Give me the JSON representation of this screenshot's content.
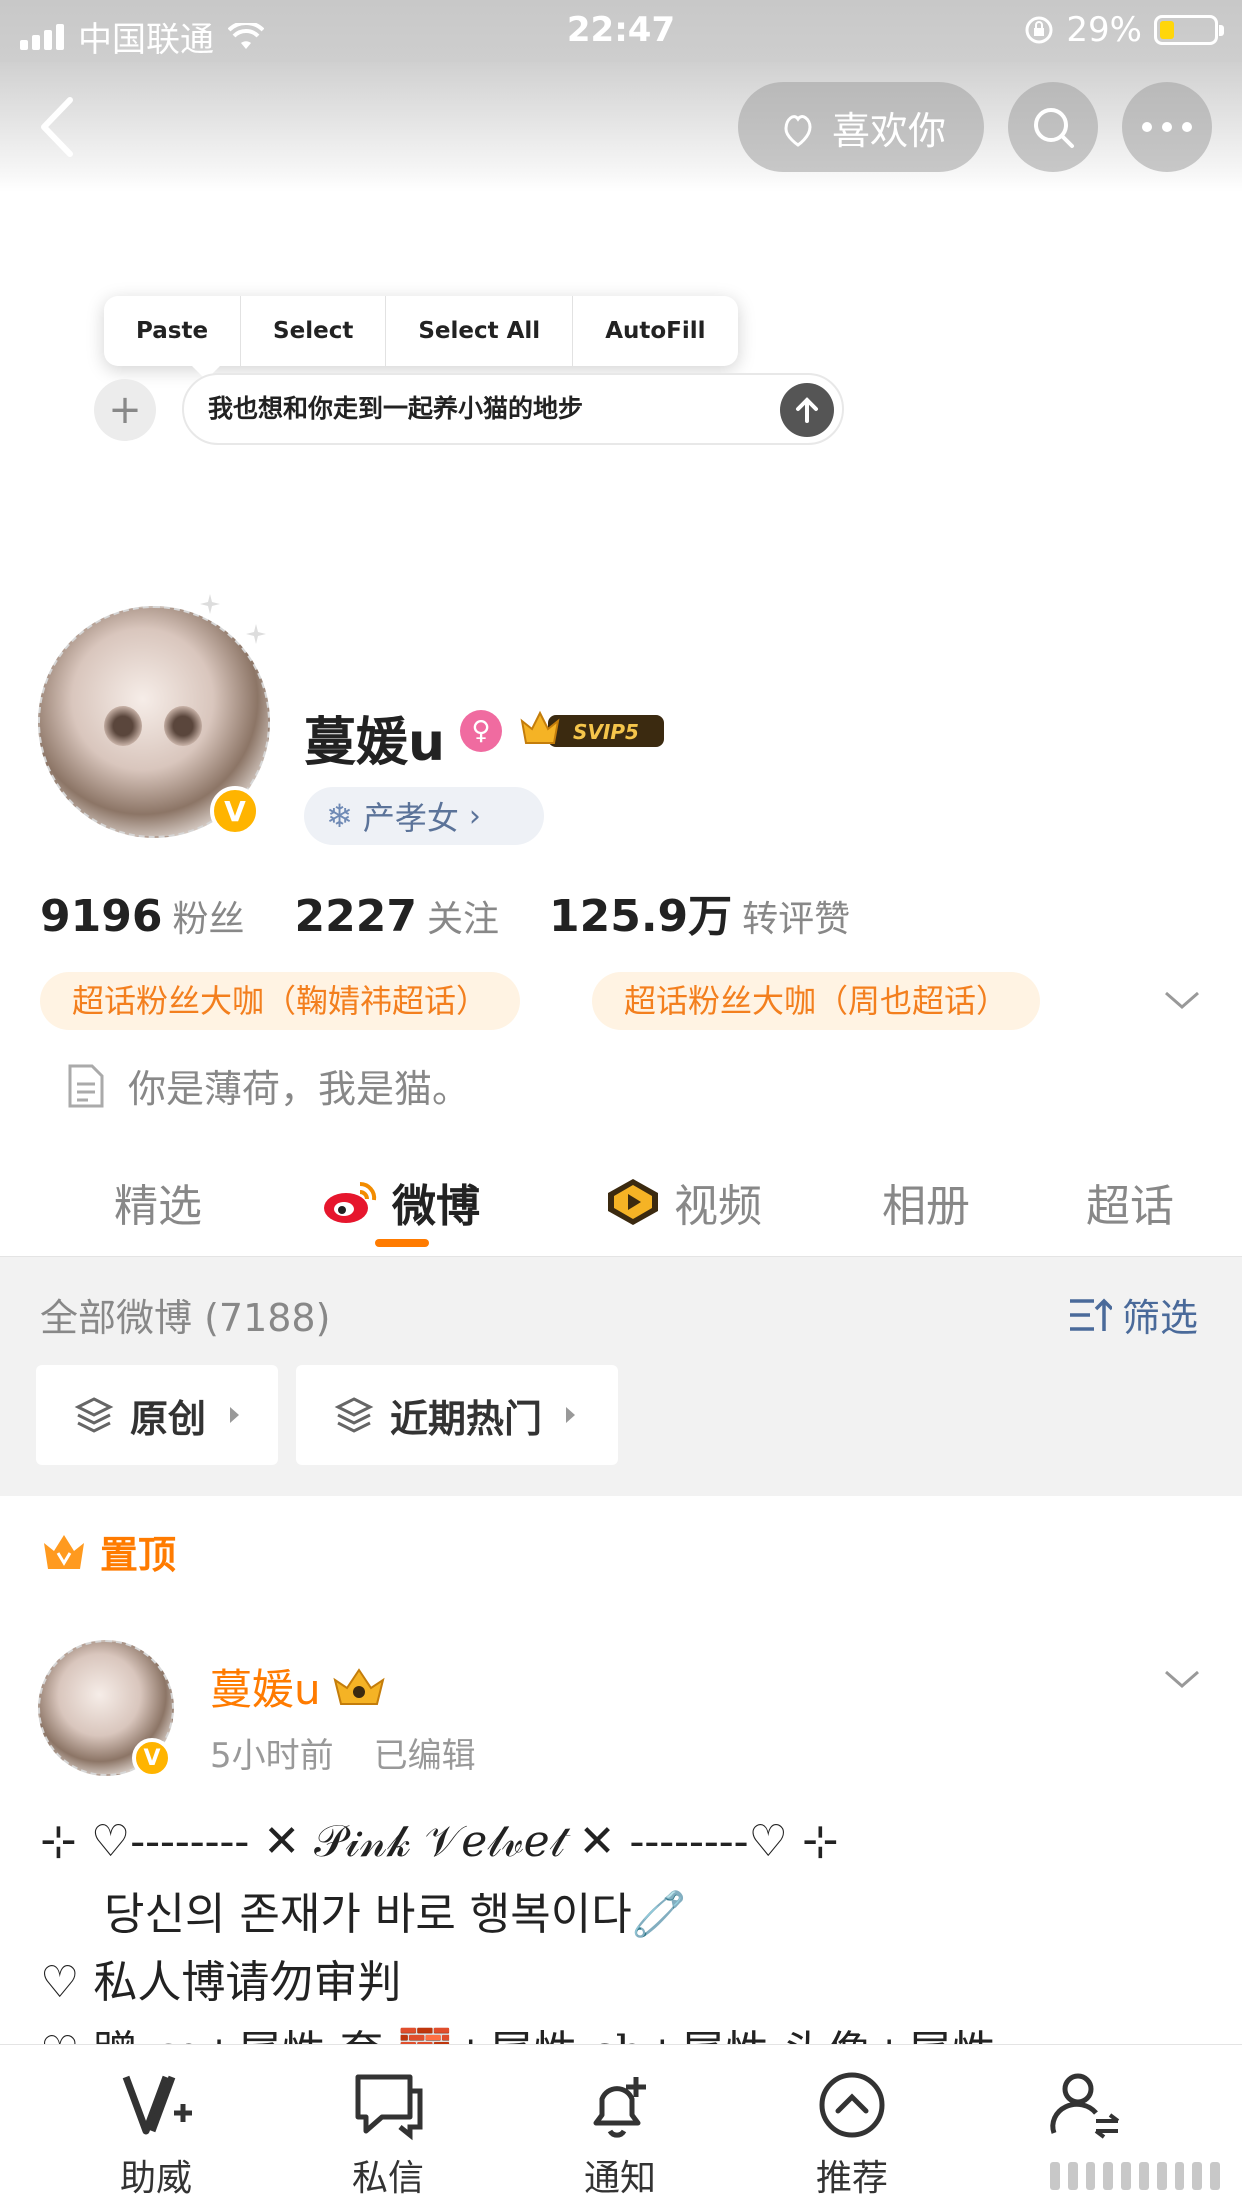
{
  "status_bar": {
    "carrier": "中国联通",
    "time": "22:47",
    "battery": "29%"
  },
  "header": {
    "like_label": "喜欢你"
  },
  "clipboard_menu": {
    "items": [
      "Paste",
      "Select",
      "Select All",
      "AutoFill"
    ]
  },
  "composer": {
    "text": "我也想和你走到一起养小猫的地步"
  },
  "profile": {
    "name": "蔓媛u",
    "svip": "SVIP5",
    "tag": "产孝女",
    "stats": [
      {
        "value": "9196",
        "label": "粉丝"
      },
      {
        "value": "2227",
        "label": "关注"
      },
      {
        "value": "125.9万",
        "label": "转评赞"
      }
    ],
    "fan_chips": [
      "超话粉丝大咖（鞠婧祎超话）",
      "超话粉丝大咖（周也超话）"
    ],
    "bio": "你是薄荷，我是猫。"
  },
  "tabs": [
    "精选",
    "微博",
    "视频",
    "相册",
    "超话"
  ],
  "filter": {
    "all_label": "全部微博 (7188)",
    "screen_label": "筛选",
    "buttons": [
      "原创",
      "近期热门"
    ]
  },
  "pinned_label": "置顶",
  "post": {
    "author": "蔓媛u",
    "time": "5小时前",
    "edited": "已编辑",
    "lines": [
      "⊹ ♡-------- ✕ 𝒫𝒾𝓃𝓀 𝒱𝑒𝓁𝓋𝑒𝓉 ✕ --------♡ ⊹",
      "당신의 존재가 바로 행복이다🧷",
      "♡ 私人博请勿审判",
      "♡ 蹭 rp+属性 套 🧱+属性 cb+属性 头像+属性"
    ]
  },
  "bottom_nav": [
    "助威",
    "私信",
    "通知",
    "推荐",
    ""
  ],
  "colors": {
    "accent": "#ff7b00",
    "link": "#4a6a9a",
    "fan_chip_bg": "#fff3e3"
  }
}
